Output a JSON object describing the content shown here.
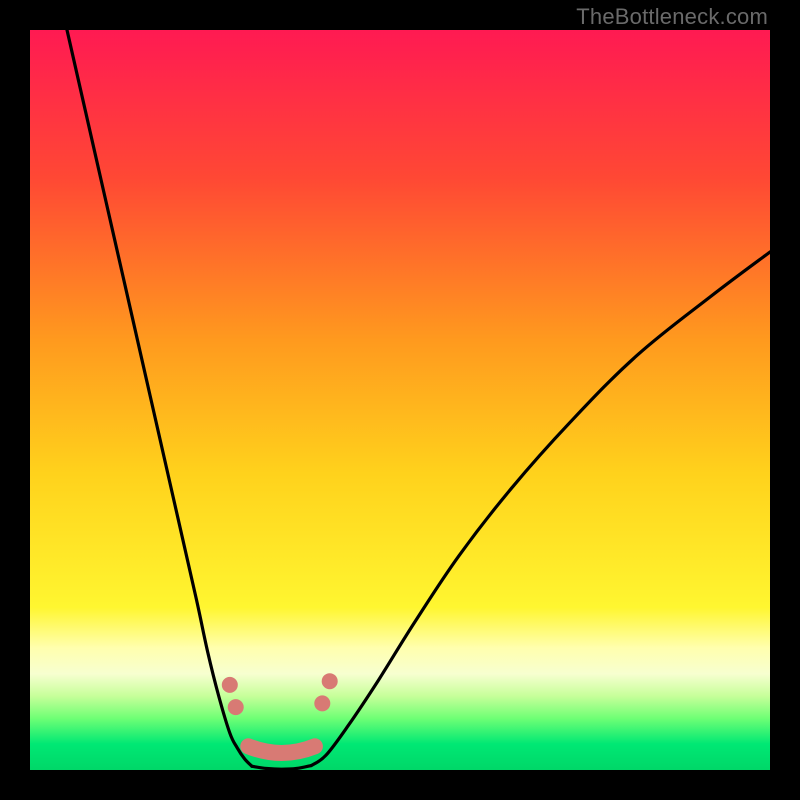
{
  "watermark": "TheBottleneck.com",
  "chart_data": {
    "type": "line",
    "title": "",
    "xlabel": "",
    "ylabel": "",
    "xlim": [
      0,
      100
    ],
    "ylim": [
      0,
      100
    ],
    "gradient_stops": [
      {
        "offset": 0,
        "color": "#ff1a52"
      },
      {
        "offset": 0.2,
        "color": "#ff4834"
      },
      {
        "offset": 0.42,
        "color": "#ff9a1e"
      },
      {
        "offset": 0.6,
        "color": "#ffd21c"
      },
      {
        "offset": 0.78,
        "color": "#fff630"
      },
      {
        "offset": 0.835,
        "color": "#ffffae"
      },
      {
        "offset": 0.87,
        "color": "#f7ffd0"
      },
      {
        "offset": 0.9,
        "color": "#c7ff9a"
      },
      {
        "offset": 0.93,
        "color": "#6fff75"
      },
      {
        "offset": 0.965,
        "color": "#00e874"
      },
      {
        "offset": 1.0,
        "color": "#00d768"
      }
    ],
    "series": [
      {
        "name": "left-branch",
        "x": [
          5.0,
          7.5,
          10.0,
          12.5,
          15.0,
          17.5,
          20.0,
          22.5,
          24.0,
          25.5,
          27.0,
          28.0,
          29.0,
          30.0
        ],
        "y": [
          100.0,
          89.0,
          78.0,
          67.0,
          56.0,
          45.0,
          34.0,
          23.0,
          16.0,
          10.0,
          5.0,
          3.0,
          1.5,
          0.5
        ]
      },
      {
        "name": "valley-floor",
        "x": [
          30.0,
          32.0,
          34.0,
          36.0,
          38.0
        ],
        "y": [
          0.5,
          0.2,
          0.1,
          0.2,
          0.6
        ]
      },
      {
        "name": "right-branch",
        "x": [
          38.0,
          40.0,
          43.0,
          47.0,
          52.0,
          58.0,
          65.0,
          73.0,
          82.0,
          92.0,
          100.0
        ],
        "y": [
          0.6,
          2.0,
          6.0,
          12.0,
          20.0,
          29.0,
          38.0,
          47.0,
          56.0,
          64.0,
          70.0
        ]
      }
    ],
    "markers": {
      "color": "#d87a74",
      "floor_segment_x": [
        29.5,
        38.5
      ],
      "left_dots_x": [
        27.0,
        27.8
      ],
      "left_dots_y": [
        11.5,
        8.5
      ],
      "right_dots_x": [
        39.5,
        40.5
      ],
      "right_dots_y": [
        9.0,
        12.0
      ]
    },
    "annotations": []
  }
}
